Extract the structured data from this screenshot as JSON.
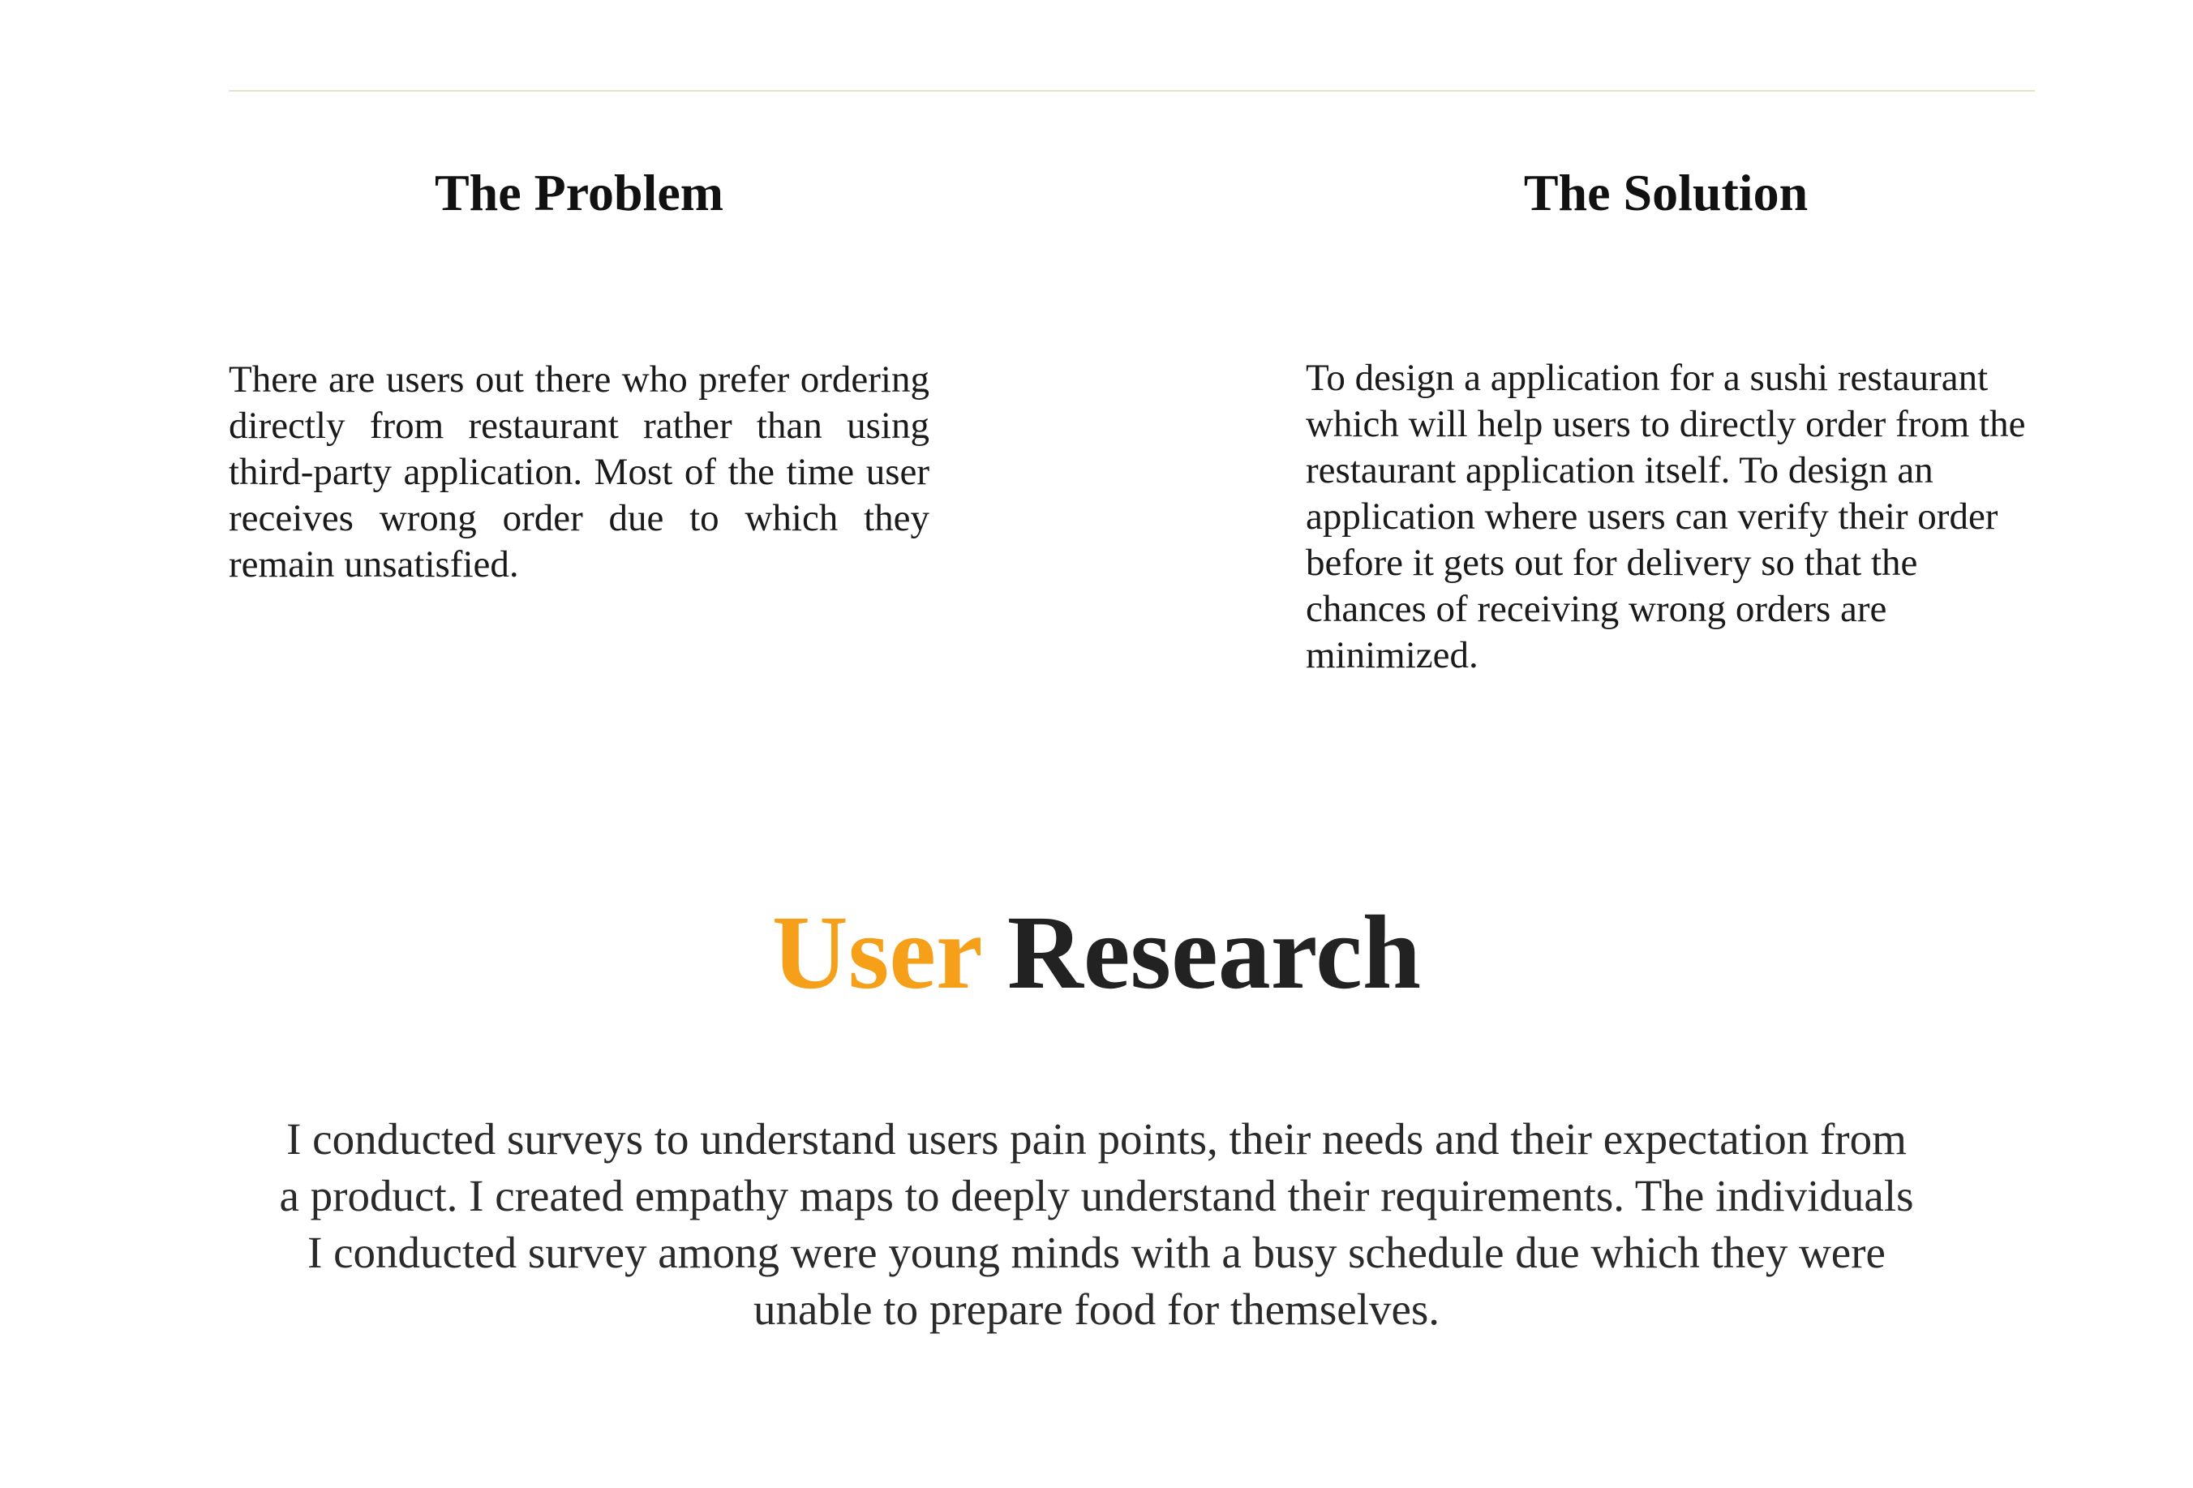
{
  "colors": {
    "accent": "#f6a01a",
    "divider": "#dfe6c9",
    "text": "#111111"
  },
  "problem": {
    "title": "The Problem",
    "body": "There are users out there who prefer ordering directly from restaurant rather than using third-party application. Most of the time user receives wrong order due to which they remain unsatisfied."
  },
  "solution": {
    "title": "The Solution",
    "body": "To design a application for a sushi restaurant which will help users to directly order from the restaurant application itself. To design an application where users can verify their order before it gets out for delivery so that the chances of receiving wrong orders are minimized."
  },
  "user_research": {
    "title_accent": "User",
    "title_rest": "Research",
    "body": "I conducted surveys to understand users pain points, their needs and their expectation from a product. I created empathy maps to deeply understand their requirements. The individuals I conducted survey among were young minds with a busy schedule due which they were unable to prepare food for themselves."
  }
}
